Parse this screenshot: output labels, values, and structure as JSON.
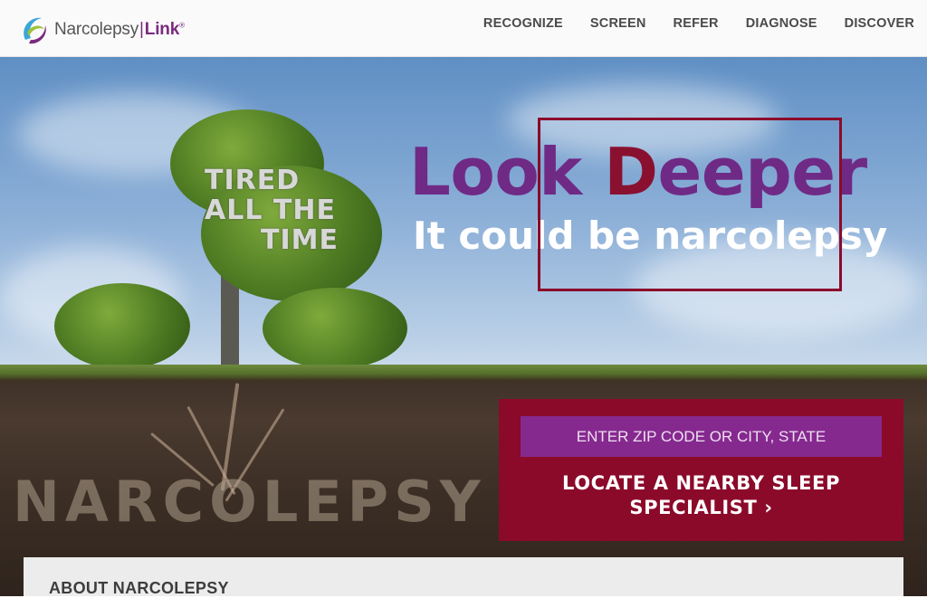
{
  "brand": {
    "name": "Narcolepsy",
    "separator": "|",
    "link": "Link",
    "mark": "®"
  },
  "nav": {
    "items": [
      {
        "label": "RECOGNIZE"
      },
      {
        "label": "SCREEN"
      },
      {
        "label": "REFER"
      },
      {
        "label": "DIAGNOSE"
      },
      {
        "label": "DISCOVER"
      }
    ]
  },
  "hero": {
    "tree_text": [
      "TIRED",
      "ALL THE",
      "TIME"
    ],
    "soil_text": "NARCOLEPSY",
    "headline_part1": "Look ",
    "headline_accent": "D",
    "headline_part2": "eeper",
    "subline": "It could be narcolepsy"
  },
  "locator": {
    "placeholder": "ENTER ZIP CODE OR CITY, STATE",
    "button_line1": "LOCATE A NEARBY SLEEP",
    "button_line2": "SPECIALIST ›"
  },
  "about": {
    "title": "ABOUT NARCOLEPSY"
  },
  "colors": {
    "brand_purple": "#6f2a86",
    "brand_red": "#8b0a2a",
    "input_purple": "#86298f"
  }
}
